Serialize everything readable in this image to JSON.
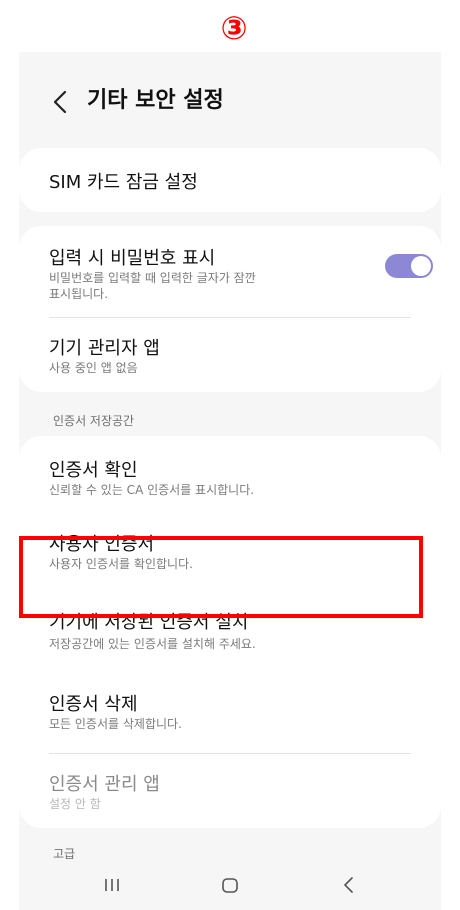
{
  "step_marker": "③",
  "header": {
    "title": "기타 보안 설정"
  },
  "sim_lock": {
    "title": "SIM 카드 잠금 설정"
  },
  "show_password": {
    "title": "입력 시 비밀번호 표시",
    "subtitle_line1": "비밀번호를 입력할 때 입력한 글자가 잠깐",
    "subtitle_line2": "표시됩니다.",
    "toggle_on": true
  },
  "device_admin": {
    "title": "기기 관리자 앱",
    "subtitle": "사용 중인 앱 없음"
  },
  "cert_storage_section": {
    "label": "인증서 저장공간"
  },
  "view_certs": {
    "title": "인증서 확인",
    "subtitle": "신뢰할 수 있는 CA 인증서를 표시합니다."
  },
  "user_certs": {
    "title": "사용자 인증서",
    "subtitle": "사용자 인증서를 확인합니다."
  },
  "install_from_device": {
    "title": "기기에 저장된 인증서 설치",
    "subtitle": "저장공간에 있는 인증서를 설치해 주세요."
  },
  "delete_certs": {
    "title": "인증서 삭제",
    "subtitle": "모든 인증서를 삭제합니다."
  },
  "cert_manager_app": {
    "title": "인증서 관리 앱",
    "subtitle": "설정 안 함"
  },
  "advanced_section": {
    "label": "고급"
  },
  "colors": {
    "highlight": "#ff0000",
    "toggle": "#8d88d6"
  },
  "icons": {
    "back": "chevron-left-icon",
    "recents": "recents-icon",
    "home": "home-icon",
    "nav_back": "back-nav-icon"
  }
}
